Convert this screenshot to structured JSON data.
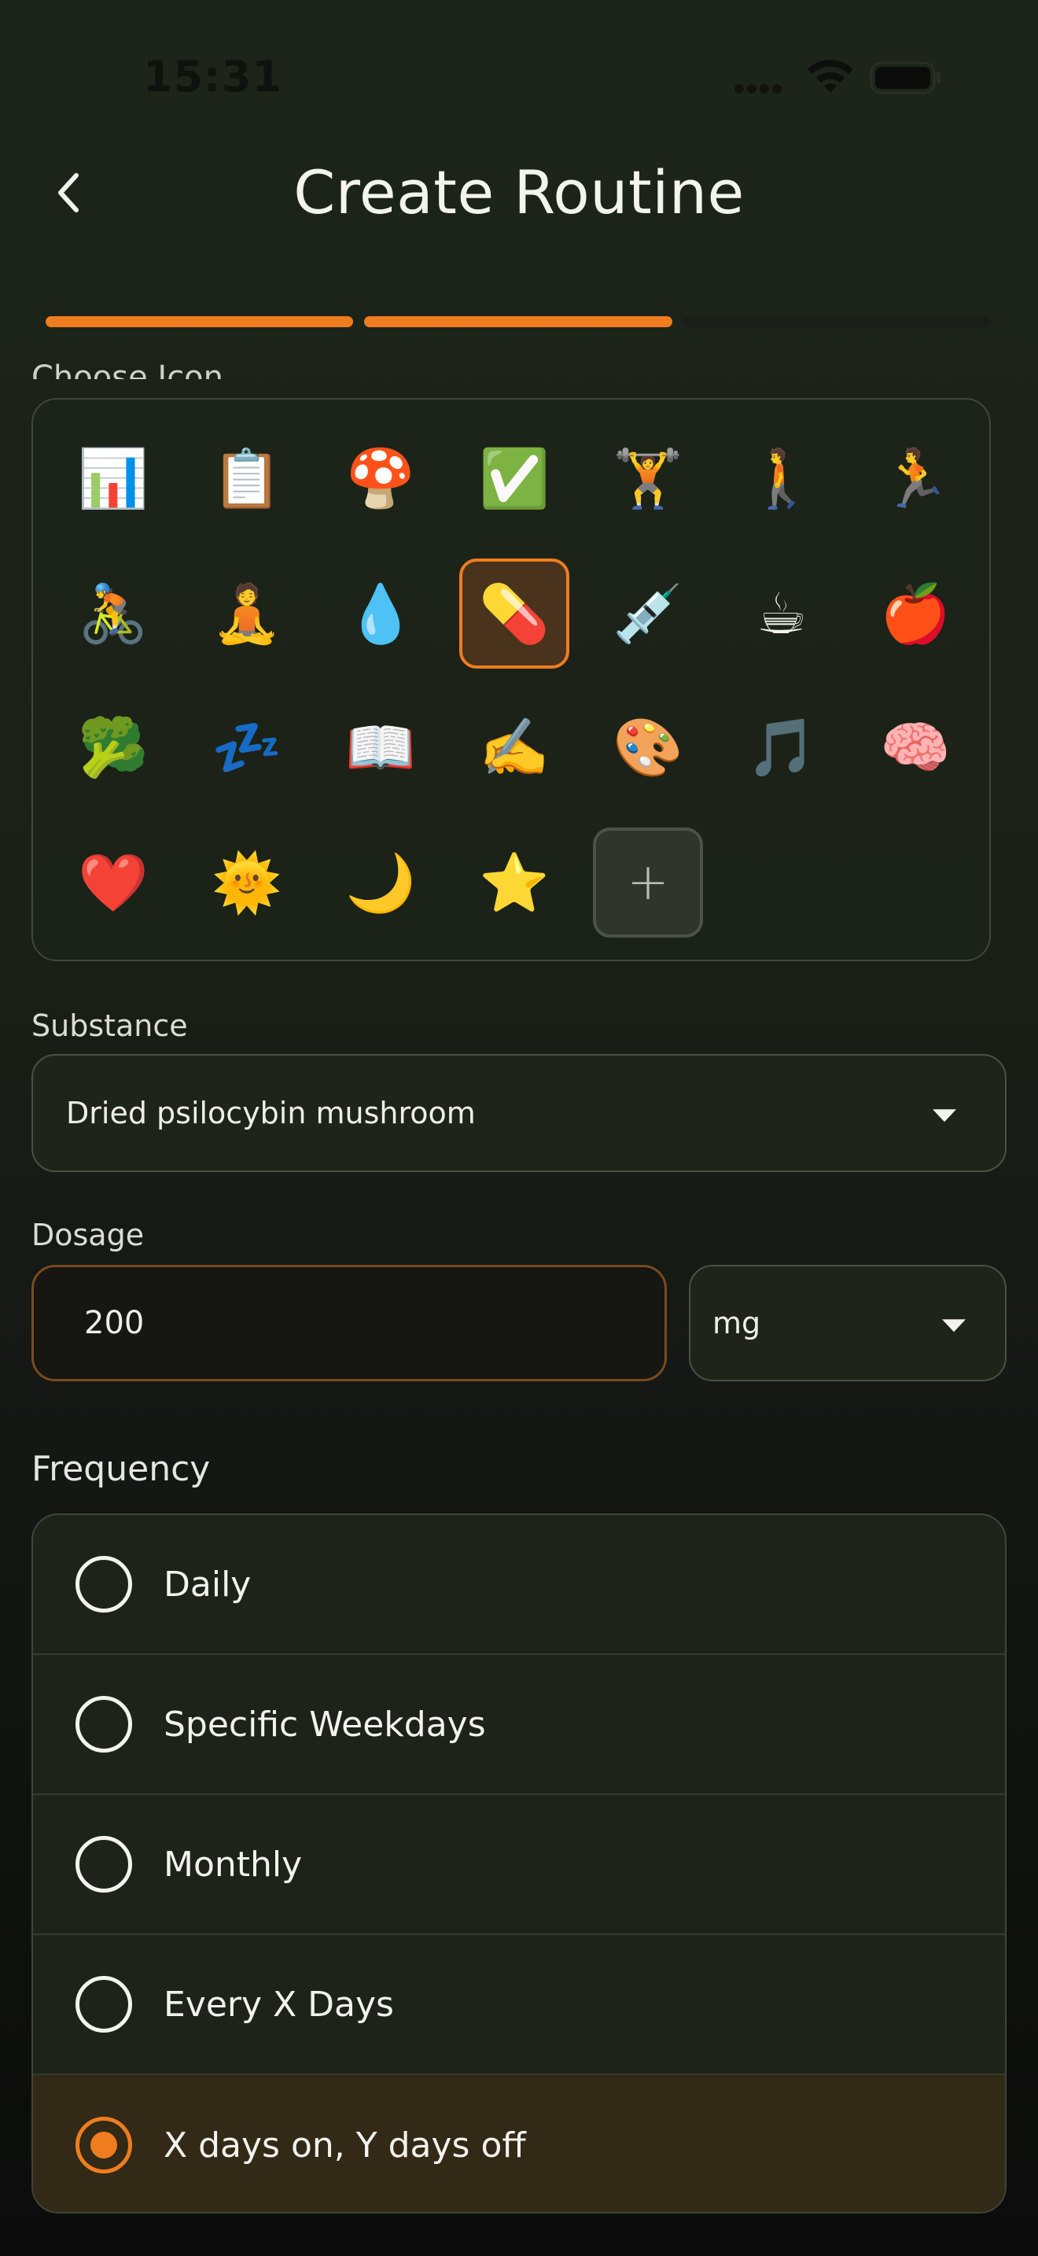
{
  "status_bar": {
    "time": "15:31"
  },
  "header": {
    "title": "Create Routine"
  },
  "progress": {
    "segments_total": 3,
    "segments_done": 2
  },
  "icon_section": {
    "label": "Choose Icon",
    "icons": [
      {
        "name": "bar-chart-icon",
        "glyph": "📊"
      },
      {
        "name": "clipboard-icon",
        "glyph": "📋"
      },
      {
        "name": "mushroom-icon",
        "glyph": "🍄"
      },
      {
        "name": "check-mark-icon",
        "glyph": "✅"
      },
      {
        "name": "weightlifter-icon",
        "glyph": "🏋️"
      },
      {
        "name": "walking-icon",
        "glyph": "🚶"
      },
      {
        "name": "running-icon",
        "glyph": "🏃"
      },
      {
        "name": "cycling-icon",
        "glyph": "🚴"
      },
      {
        "name": "meditation-icon",
        "glyph": "🧘"
      },
      {
        "name": "droplet-icon",
        "glyph": "💧"
      },
      {
        "name": "pill-icon",
        "glyph": "💊",
        "selected": true
      },
      {
        "name": "syringe-icon",
        "glyph": "💉"
      },
      {
        "name": "coffee-icon",
        "glyph": "☕"
      },
      {
        "name": "apple-icon",
        "glyph": "🍎"
      },
      {
        "name": "broccoli-icon",
        "glyph": "🥦"
      },
      {
        "name": "sleep-icon",
        "glyph": "💤"
      },
      {
        "name": "book-icon",
        "glyph": "📖"
      },
      {
        "name": "writing-hand-icon",
        "glyph": "✍️"
      },
      {
        "name": "palette-icon",
        "glyph": "🎨"
      },
      {
        "name": "music-note-icon",
        "glyph": "🎵"
      },
      {
        "name": "brain-icon",
        "glyph": "🧠"
      },
      {
        "name": "heart-icon",
        "glyph": "❤️"
      },
      {
        "name": "sun-icon",
        "glyph": "🌞"
      },
      {
        "name": "moon-icon",
        "glyph": "🌙"
      },
      {
        "name": "star-icon",
        "glyph": "⭐"
      }
    ],
    "add_glyph": "+"
  },
  "substance": {
    "label": "Substance",
    "value": "Dried psilocybin mushroom"
  },
  "dosage": {
    "label": "Dosage",
    "value": "200",
    "unit": "mg"
  },
  "frequency": {
    "label": "Frequency",
    "options": [
      {
        "label": "Daily",
        "selected": false
      },
      {
        "label": "Specific Weekdays",
        "selected": false
      },
      {
        "label": "Monthly",
        "selected": false
      },
      {
        "label": "Every X Days",
        "selected": false
      },
      {
        "label": "X days on, Y days off",
        "selected": true
      }
    ]
  },
  "colors": {
    "accent": "#ef7d1f",
    "background": "#1d2419",
    "panel_border": "#3f4639"
  }
}
